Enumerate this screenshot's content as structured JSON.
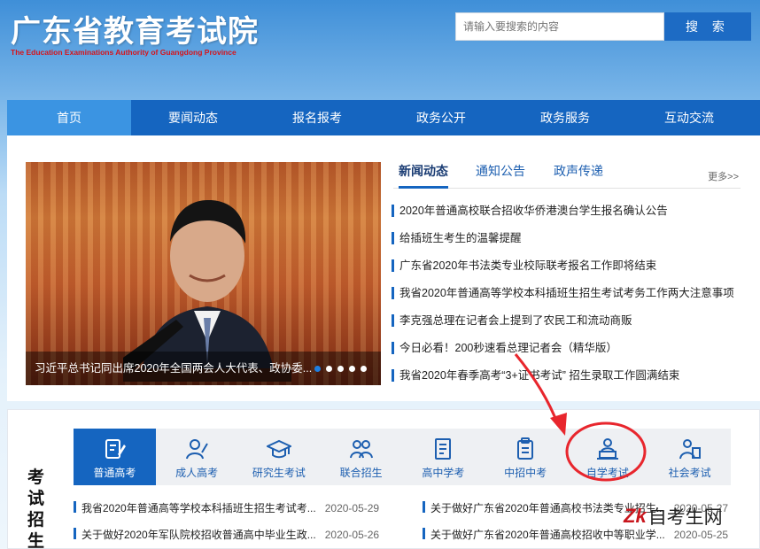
{
  "header": {
    "title": "广东省教育考试院",
    "subtitle": "The Education Examinations Authority of Guangdong Province",
    "search_placeholder": "请输入要搜索的内容",
    "search_button": "搜 索"
  },
  "nav": {
    "items": [
      "首页",
      "要闻动态",
      "报名报考",
      "政务公开",
      "政务服务",
      "互动交流"
    ],
    "active": 0
  },
  "slideshow": {
    "caption": "习近平总书记同出席2020年全国两会人大代表、政协委...",
    "slide_count": 5,
    "active_slide": 0
  },
  "news": {
    "tabs": [
      "新闻动态",
      "通知公告",
      "政声传递"
    ],
    "active_tab": 0,
    "more": "更多>>",
    "items": [
      "2020年普通高校联合招收华侨港澳台学生报名确认公告",
      "给插班生考生的温馨提醒",
      "广东省2020年书法类专业校际联考报名工作即将结束",
      "我省2020年普通高等学校本科插班生招生考试考务工作两大注意事项",
      "李克强总理在记者会上提到了农民工和流动商贩",
      "今日必看！200秒速看总理记者会（精华版）",
      "我省2020年春季高考“3+证书考试” 招生录取工作圆满结束"
    ]
  },
  "exam": {
    "label": [
      "考",
      "试",
      "招",
      "生"
    ],
    "categories": [
      {
        "label": "普通高考",
        "icon": "pen-paper-icon"
      },
      {
        "label": "成人高考",
        "icon": "person-pen-icon"
      },
      {
        "label": "研究生考试",
        "icon": "graduation-cap-icon"
      },
      {
        "label": "联合招生",
        "icon": "group-icon"
      },
      {
        "label": "高中学考",
        "icon": "document-icon"
      },
      {
        "label": "中招中考",
        "icon": "clipboard-icon"
      },
      {
        "label": "自学考试",
        "icon": "laptop-person-icon"
      },
      {
        "label": "社会考试",
        "icon": "person-doc-icon"
      }
    ],
    "active_category": 0,
    "rows": [
      {
        "title": "我省2020年普通高等学校本科插班生招生考试考...",
        "date": "2020-05-29"
      },
      {
        "title": "关于做好广东省2020年普通高校书法类专业招生...",
        "date": "2020-05-27"
      },
      {
        "title": "关于做好2020年军队院校招收普通高中毕业生政...",
        "date": "2020-05-26"
      },
      {
        "title": "关于做好广东省2020年普通高校招收中等职业学...",
        "date": "2020-05-25"
      }
    ]
  },
  "watermark": {
    "logo": "Zk",
    "text": "自考生网"
  },
  "colors": {
    "primary": "#1565c0",
    "nav_active": "#3b94e2",
    "highlight": "#e8262d",
    "subtitle": "#d6141b"
  }
}
